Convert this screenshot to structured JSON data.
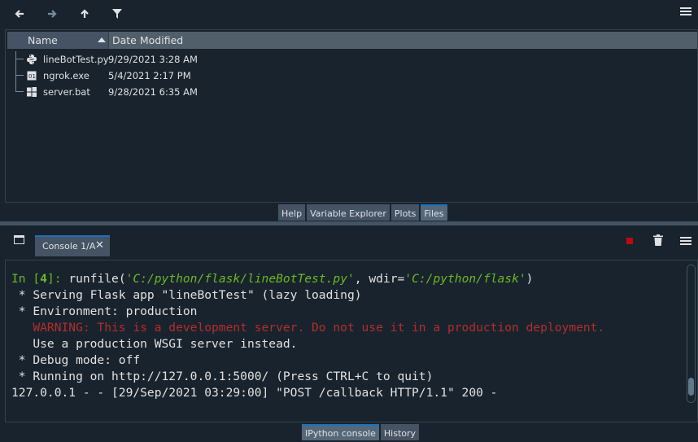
{
  "files_toolbar": {
    "back_icon": "arrow-left-icon",
    "forward_icon": "arrow-right-icon",
    "up_icon": "arrow-up-icon",
    "filter_icon": "filter-icon",
    "menu_icon": "hamburger-menu-icon"
  },
  "files_header": {
    "name": "Name",
    "date": "Date Modified"
  },
  "files": [
    {
      "name": "lineBotTest.py",
      "date": "9/29/2021 3:28 AM",
      "icon": "python-file-icon"
    },
    {
      "name": "ngrok.exe",
      "date": "5/4/2021 2:17 PM",
      "icon": "exe-file-icon"
    },
    {
      "name": "server.bat",
      "date": "9/28/2021 6:35 AM",
      "icon": "windows-batch-file-icon"
    }
  ],
  "upper_tabs": [
    "Help",
    "Variable Explorer",
    "Plots",
    "Files"
  ],
  "upper_active_tab": "Files",
  "console": {
    "tab_label": "Console 1/A",
    "close_glyph": "✕",
    "prompt_prefix": "In [",
    "prompt_number": "4",
    "prompt_suffix": "]: ",
    "cmd_runfile": "runfile(",
    "cmd_path": "'C:/python/flask/lineBotTest.py'",
    "cmd_wdir": ", wdir=",
    "cmd_wdir_value": "'C:/python/flask'",
    "cmd_close": ")",
    "lines": [
      " * Serving Flask app \"lineBotTest\" (lazy loading)",
      " * Environment: production"
    ],
    "warning": "   WARNING: This is a development server. Do not use it in a production deployment.",
    "lines2": [
      "   Use a production WSGI server instead.",
      " * Debug mode: off",
      " * Running on http://127.0.0.1:5000/ (Press CTRL+C to quit)",
      "127.0.0.1 - - [29/Sep/2021 03:29:00] \"POST /callback HTTP/1.1\" 200 -"
    ],
    "stop_icon": "stop-icon",
    "trash_icon": "trash-icon"
  },
  "lower_tabs": [
    "IPython console",
    "History"
  ],
  "lower_active_tab": "IPython console",
  "colors": {
    "background": "#19232d",
    "accent": "#1a72bb",
    "prompt_green": "#6ab825",
    "warning_red": "#b32d2d",
    "stop_red": "#c1090b"
  }
}
